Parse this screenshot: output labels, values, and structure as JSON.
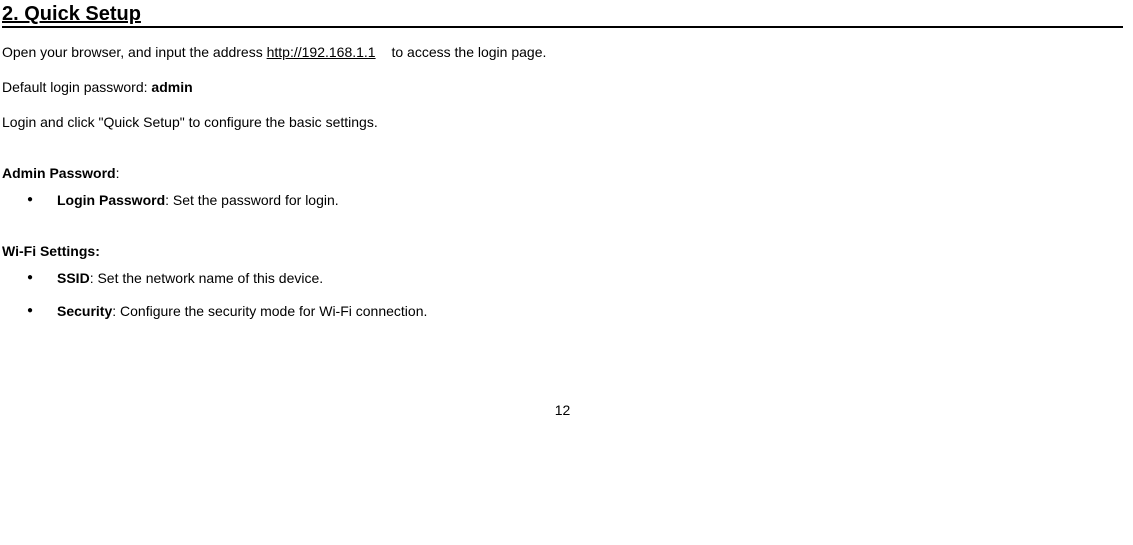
{
  "title": "2. Quick Setup",
  "intro": {
    "prefix": "Open your browser, and input the address ",
    "url": "http://192.168.1.1",
    "suffix": "to access the login page."
  },
  "defaultLogin": {
    "label": "Default login password: ",
    "value": "admin"
  },
  "loginInstruction": "Login and click \"Quick Setup\" to configure the basic settings.",
  "adminPassword": {
    "heading": "Admin Password",
    "items": [
      {
        "term": "Login Password",
        "desc": ": Set the password for login."
      }
    ]
  },
  "wifiSettings": {
    "heading": "Wi-Fi Settings:",
    "items": [
      {
        "term": "SSID",
        "desc": ": Set the network name of this device."
      },
      {
        "term": "Security",
        "desc": ": Configure the security mode for Wi-Fi connection."
      }
    ]
  },
  "pageNumber": "12"
}
